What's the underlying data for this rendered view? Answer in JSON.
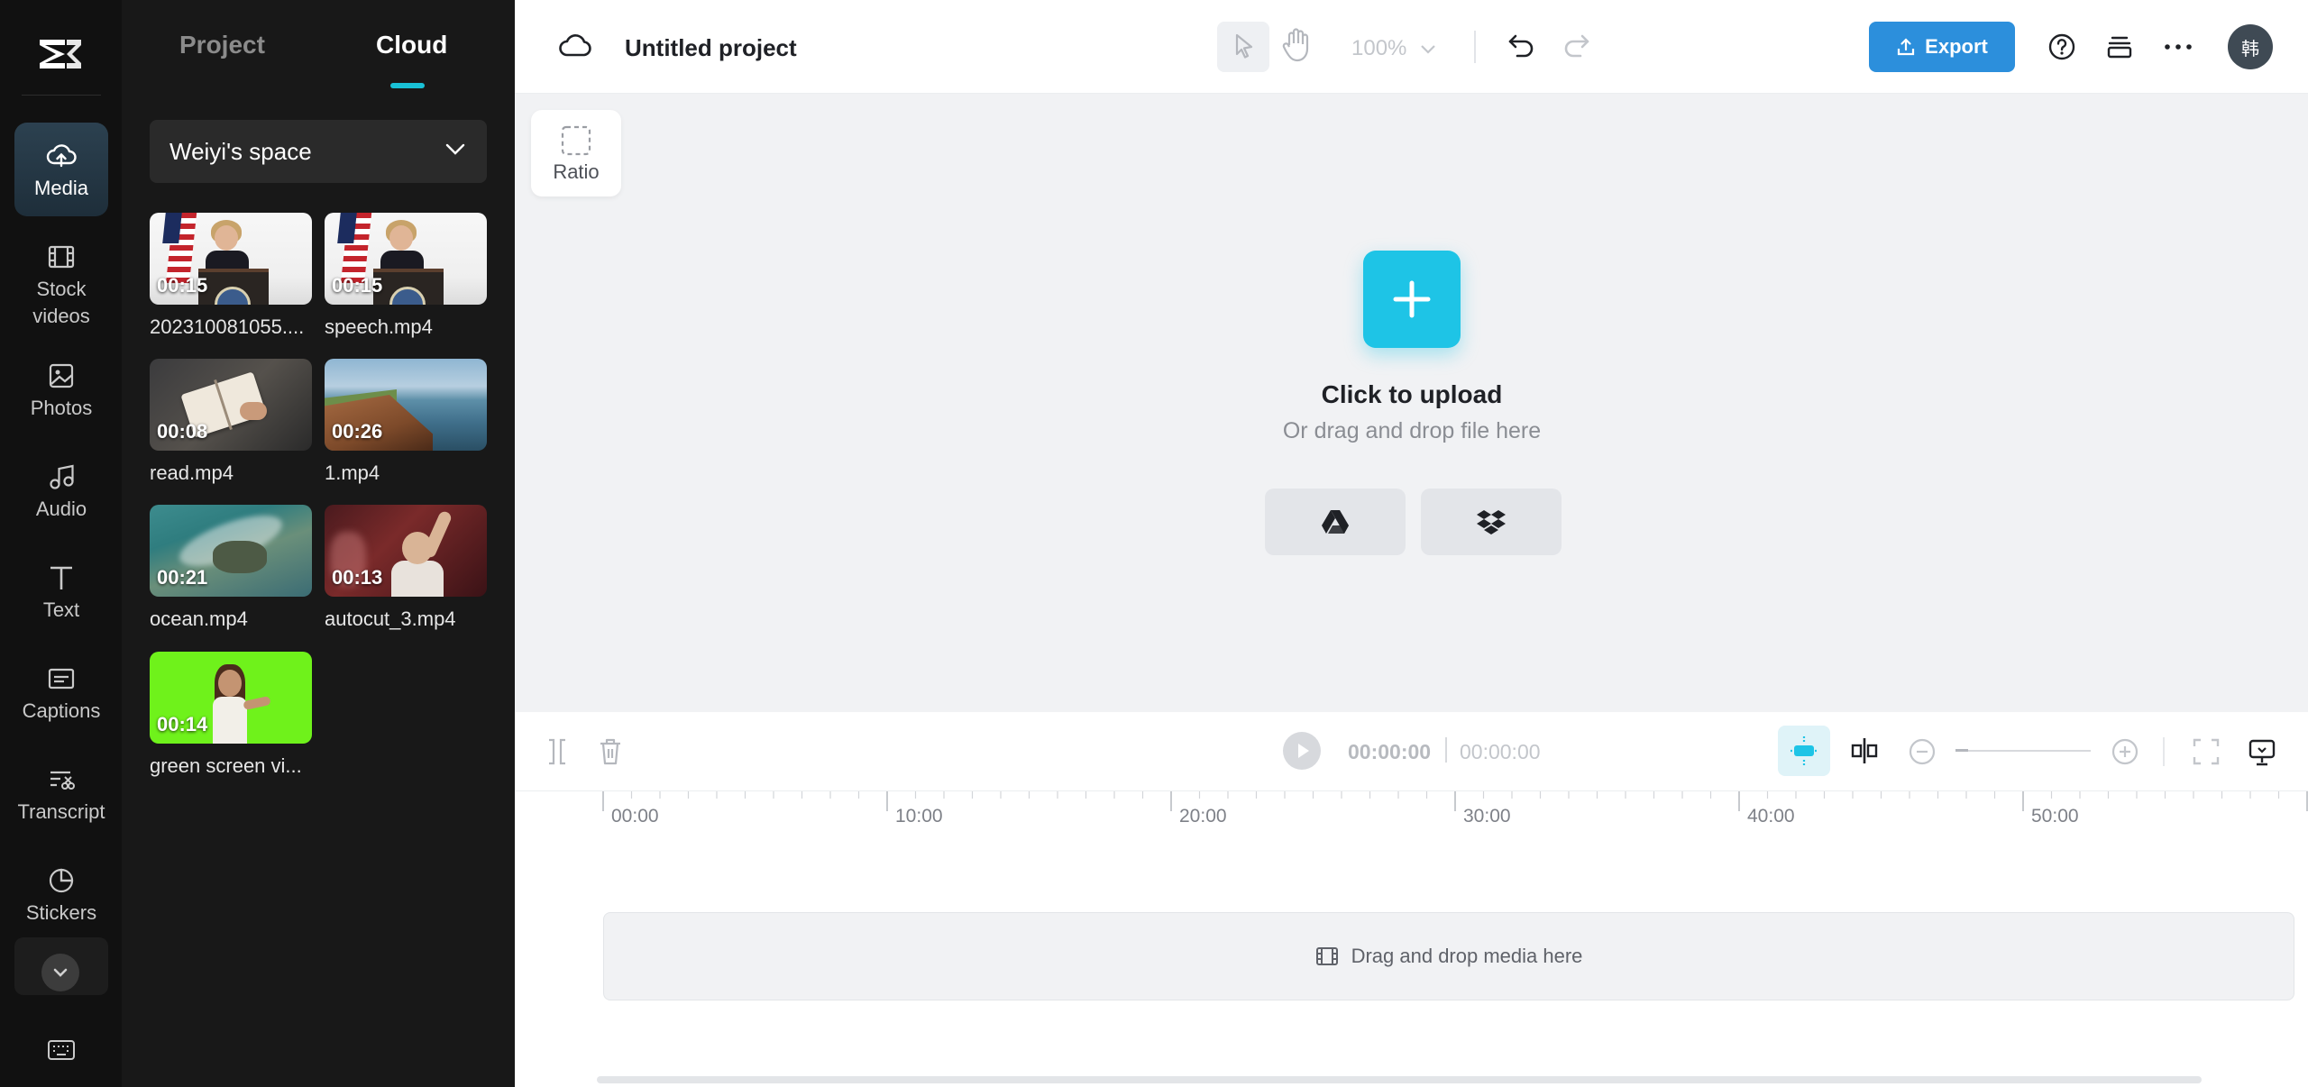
{
  "sidebar": {
    "items": [
      {
        "key": "media",
        "label": "Media",
        "active": true
      },
      {
        "key": "stock",
        "label": "Stock videos"
      },
      {
        "key": "photos",
        "label": "Photos"
      },
      {
        "key": "audio",
        "label": "Audio"
      },
      {
        "key": "text",
        "label": "Text"
      },
      {
        "key": "captions",
        "label": "Captions"
      },
      {
        "key": "transcript",
        "label": "Transcript"
      },
      {
        "key": "stickers",
        "label": "Stickers"
      }
    ]
  },
  "panel": {
    "tabs": [
      {
        "label": "Project",
        "active": false
      },
      {
        "label": "Cloud",
        "active": true
      }
    ],
    "space": "Weiyi's space",
    "media": [
      {
        "name": "202310081055....",
        "duration": "00:15"
      },
      {
        "name": "speech.mp4",
        "duration": "00:15"
      },
      {
        "name": "read.mp4",
        "duration": "00:08"
      },
      {
        "name": "1.mp4",
        "duration": "00:26"
      },
      {
        "name": "ocean.mp4",
        "duration": "00:21"
      },
      {
        "name": "autocut_3.mp4",
        "duration": "00:13"
      },
      {
        "name": "green screen vi...",
        "duration": "00:14"
      }
    ]
  },
  "topbar": {
    "title": "Untitled project",
    "zoom": "100%",
    "export_label": "Export",
    "avatar_text": "韩"
  },
  "canvas": {
    "ratio_label": "Ratio",
    "upload_title": "Click to upload",
    "upload_sub": "Or drag and drop file here"
  },
  "timeline": {
    "current_time": "00:00:00",
    "total_time": "00:00:00",
    "ruler": [
      "00:00",
      "10:00",
      "20:00",
      "30:00",
      "40:00",
      "50:00"
    ],
    "drop_text": "Drag and drop media here"
  },
  "colors": {
    "accent": "#1ec4e6",
    "export": "#2c8fdc",
    "rail_bg": "#111111",
    "panel_bg": "#181818"
  }
}
